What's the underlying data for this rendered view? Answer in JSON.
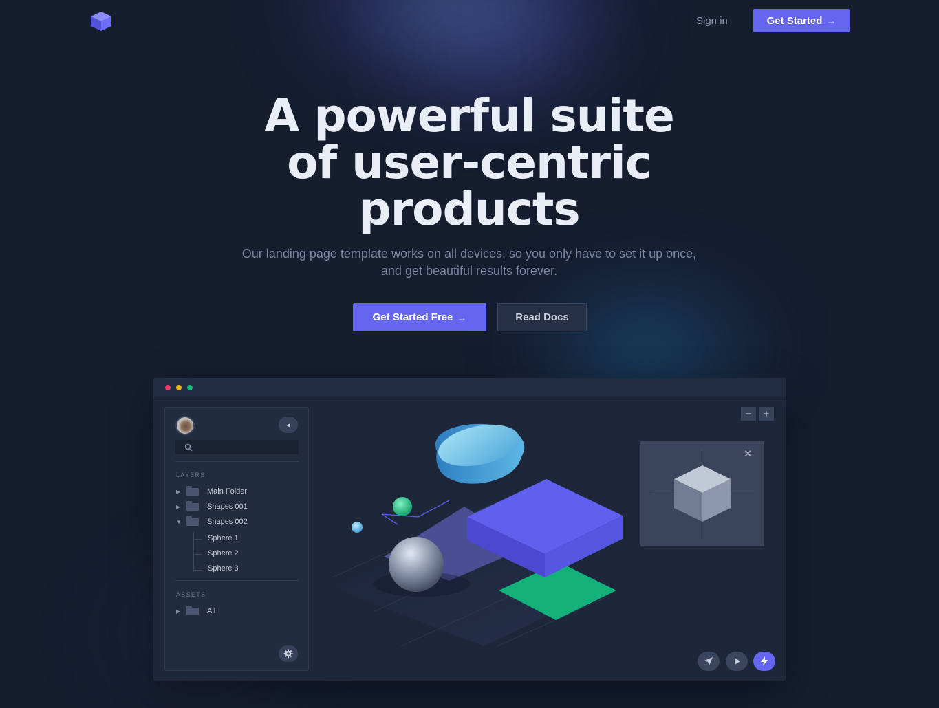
{
  "header": {
    "logo_icon": "cube-logo-icon",
    "signin_label": "Sign in",
    "cta_label": "Get Started",
    "cta_arrow": "→"
  },
  "hero": {
    "title_lines": [
      "A powerful suite",
      "of user-centric",
      "products"
    ],
    "subtitle_lines": [
      "Our landing page template works on all devices, so you only have to set it up once,",
      "and get beautiful results forever."
    ],
    "primary_label": "Get Started Free",
    "primary_arrow": "→",
    "secondary_label": "Read Docs"
  },
  "app": {
    "search": {
      "value": "",
      "placeholder": ""
    },
    "layers_label": "LAYERS",
    "layers": [
      {
        "label": "Main Folder",
        "expanded": false
      },
      {
        "label": "Shapes 001",
        "expanded": false
      },
      {
        "label": "Shapes 002",
        "expanded": true
      }
    ],
    "sublayers": [
      "Sphere 1",
      "Sphere 2",
      "Sphere 3"
    ],
    "assets_label": "ASSETS",
    "assets": [
      {
        "label": "All",
        "expanded": false
      }
    ],
    "zoom_out": "−",
    "zoom_in": "+",
    "preview_close": "✕"
  },
  "colors": {
    "background": "#151d2f",
    "accent": "#6566f0",
    "green": "#15b57c",
    "window": "#1d2739"
  }
}
